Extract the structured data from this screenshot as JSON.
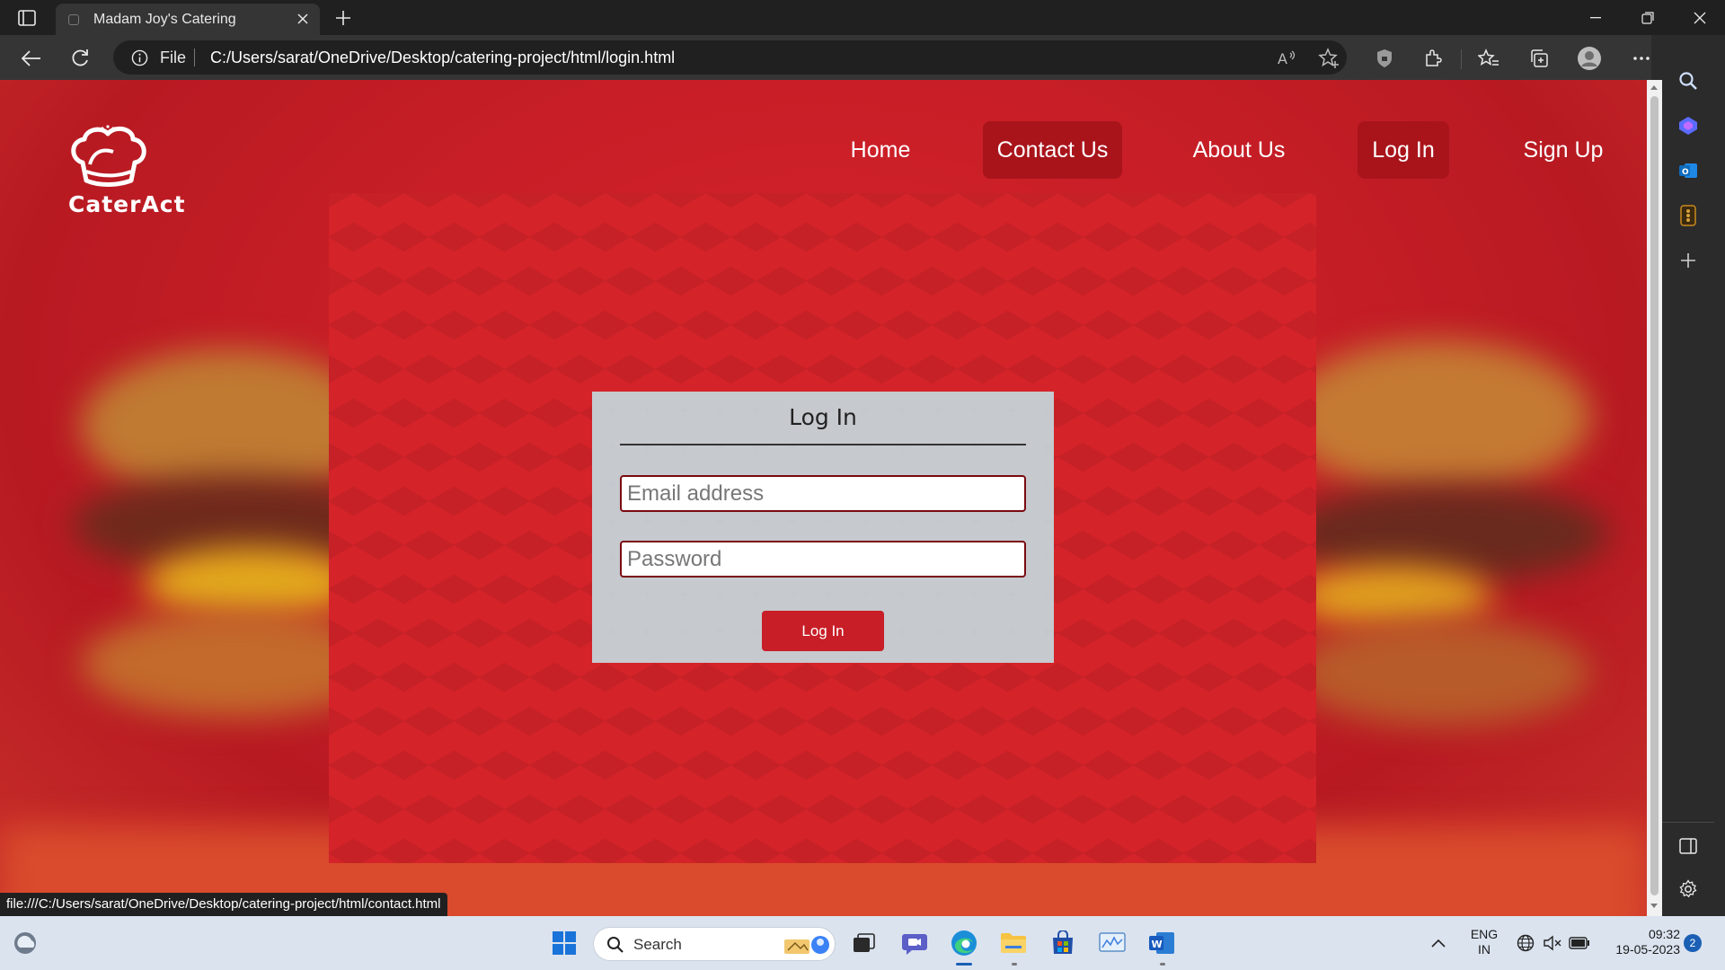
{
  "browser": {
    "tab_title": "Madam Joy's Catering",
    "file_label": "File",
    "url": "C:/Users/sarat/OneDrive/Desktop/catering-project/html/login.html",
    "status_url": "file:///C:/Users/sarat/OneDrive/Desktop/catering-project/html/contact.html"
  },
  "site": {
    "logo_text": "CaterAct",
    "nav": [
      {
        "label": "Home",
        "active": false
      },
      {
        "label": "Contact Us",
        "active": true
      },
      {
        "label": "About Us",
        "active": false
      },
      {
        "label": "Log In",
        "active": true
      },
      {
        "label": "Sign Up",
        "active": false
      }
    ]
  },
  "login": {
    "title": "Log In",
    "email_placeholder": "Email address",
    "password_placeholder": "Password",
    "button_label": "Log In"
  },
  "taskbar": {
    "search_label": "Search",
    "lang_line1": "ENG",
    "lang_line2": "IN",
    "time": "09:32",
    "date": "19-05-2023",
    "notification_count": "2"
  },
  "colors": {
    "brand_red": "#c81e27",
    "nav_active": "#a9141b",
    "browser_dark": "#202020"
  }
}
